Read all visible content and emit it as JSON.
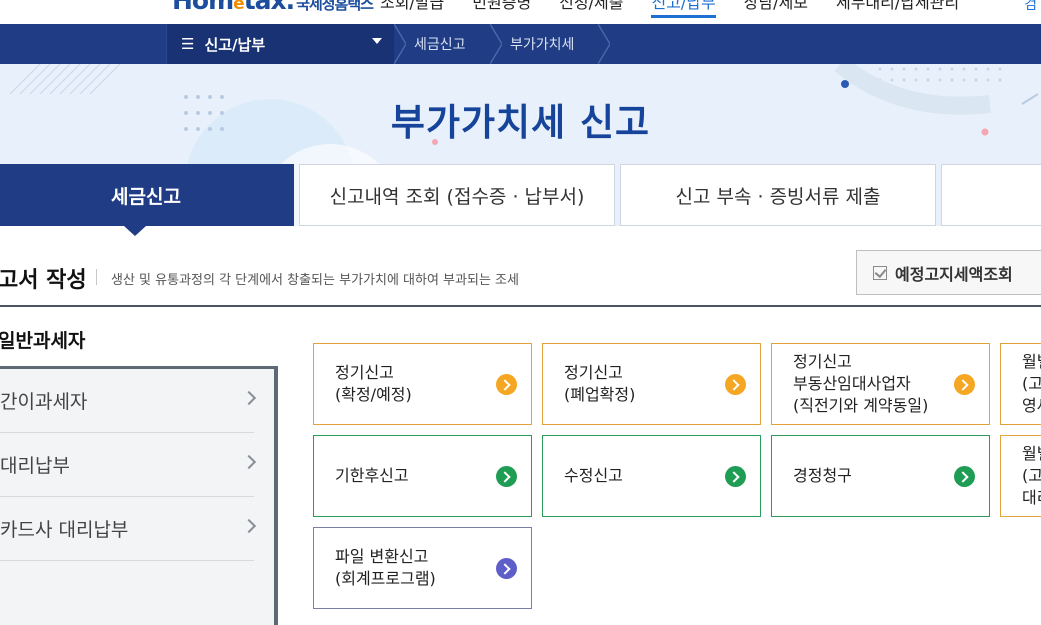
{
  "header": {
    "logo_main": "Hom",
    "logo_e": "e",
    "logo_tax": "tax.",
    "logo_sub": "국세청홈택스",
    "nav": [
      "조회/발급",
      "민원증명",
      "신청/제출",
      "신고/납부",
      "상담/제보",
      "세무대리/납세관리"
    ],
    "active_nav_index": 3,
    "top_right_glyph": "검"
  },
  "breadcrumb": {
    "menu_label": "신고/납부",
    "items": [
      "세금신고",
      "부가가치세"
    ]
  },
  "hero": {
    "title": "부가가치세 신고"
  },
  "tabs": [
    {
      "label": "세금신고",
      "active": true
    },
    {
      "label": "신고내역 조회 (접수증 · 납부서)",
      "active": false
    },
    {
      "label": "신고 부속 · 증빙서류 제출",
      "active": false
    },
    {
      "label": "",
      "active": false
    }
  ],
  "section": {
    "title": "고서 작성",
    "description": "생산 및 유통과정의 각 단계에서 창출되는 부가가치에 대하여 부과되는 조세",
    "notice_button": "예정고지세액조회"
  },
  "sidebar": {
    "title": "일반과세자",
    "items": [
      "간이과세자",
      "대리납부",
      "카드사 대리납부"
    ]
  },
  "cards": {
    "row1": [
      {
        "label": "정기신고\n(확정/예정)",
        "color": "orange"
      },
      {
        "label": "정기신고\n(폐업확정)",
        "color": "orange"
      },
      {
        "label": "정기신고\n부동산임대사업자\n(직전기와 계약동일)",
        "color": "orange"
      },
      {
        "label": "월별\n(고\n영세",
        "color": "orange"
      }
    ],
    "row2": [
      {
        "label": "기한후신고",
        "color": "green"
      },
      {
        "label": "수정신고",
        "color": "green"
      },
      {
        "label": "경정청구",
        "color": "green"
      },
      {
        "label": "월별\n(고\n대리",
        "color": "orange"
      }
    ],
    "row3": [
      {
        "label": "파일 변환신고\n(회계프로그램)",
        "color": "purple"
      }
    ]
  },
  "colors": {
    "brand_navy": "#1f3c84",
    "hero_bg": "#e8f1fb",
    "orange_accent": "#f5a623",
    "green_accent": "#1f9d55",
    "purple_accent": "#5e5ec9"
  }
}
